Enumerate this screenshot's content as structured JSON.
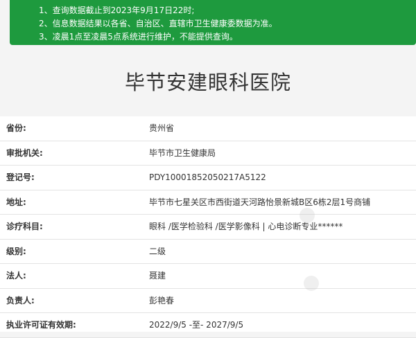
{
  "notice": {
    "lines": [
      "1、查询数据截止到2023年9月17日22时;",
      "2、信息数据结果以各省、自治区、直辖市卫生健康委数据为准。",
      "3、凌晨1点至凌晨5点系统进行维护，不能提供查询。"
    ]
  },
  "hospital": {
    "name": "毕节安建眼科医院"
  },
  "info": {
    "rows": [
      {
        "label": "省份:",
        "value": "贵州省"
      },
      {
        "label": "审批机关:",
        "value": "毕节市卫生健康局"
      },
      {
        "label": "登记号:",
        "value": "PDY10001852050217A5122"
      },
      {
        "label": "地址:",
        "value": "毕节市七星关区市西街道天河路怡景新城B区6栋2层1号商铺"
      },
      {
        "label": "诊疗科目:",
        "value": "眼科 /医学检验科 /医学影像科 | 心电诊断专业******"
      },
      {
        "label": "级别:",
        "value": "二级"
      },
      {
        "label": "法人:",
        "value": "聂建"
      },
      {
        "label": "负责人:",
        "value": "彭艳春"
      },
      {
        "label": "执业许可证有效期:",
        "value": "2022/9/5 -至- 2027/9/5"
      }
    ]
  },
  "colors": {
    "notice_bg": "#1e9a3e",
    "page_bg": "#f4f4f4",
    "row_border": "#e3e3e3"
  }
}
